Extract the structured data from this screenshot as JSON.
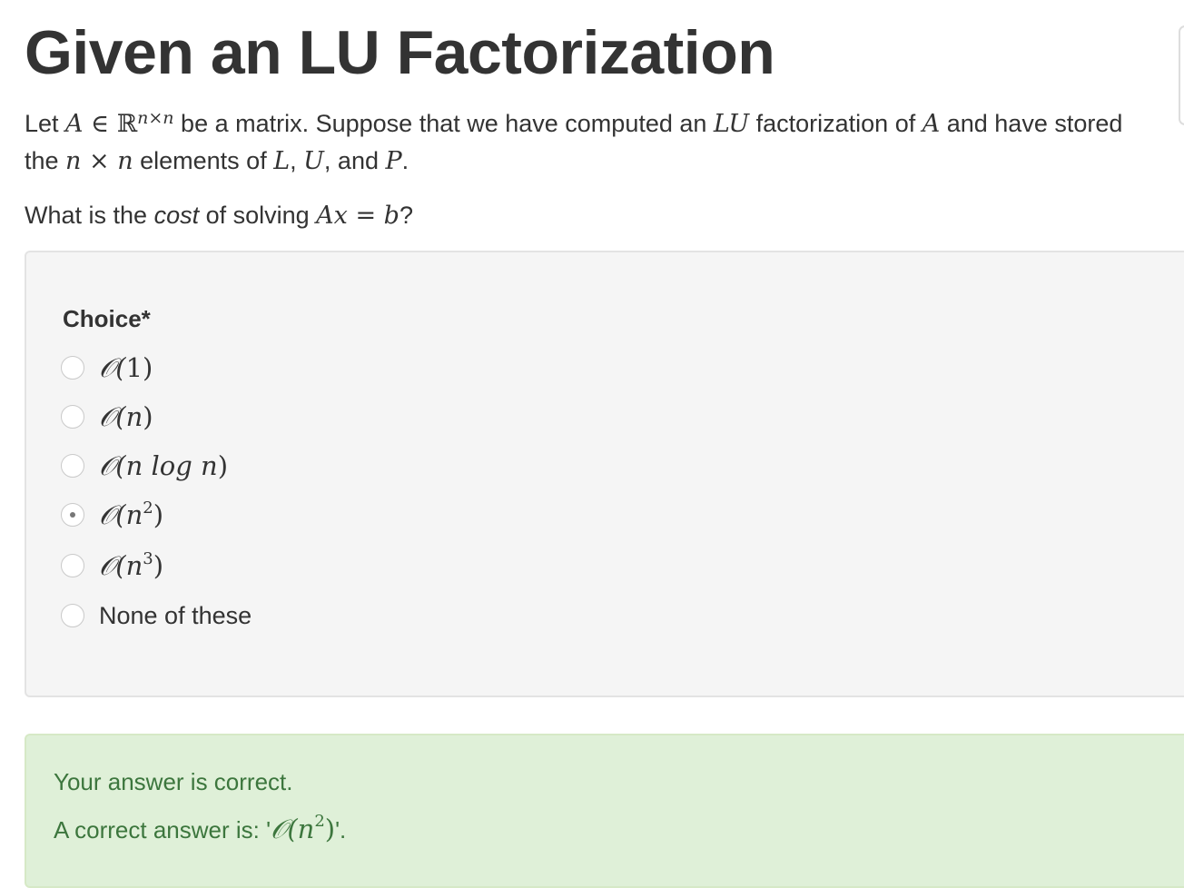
{
  "page": {
    "title": "Given an LU Factorization"
  },
  "question": {
    "p1_let": "Let ",
    "p1_A": "A",
    "p1_in": " ∈ ℝ",
    "p1_sup": "n×n",
    "p1_rest1": " be a matrix. Suppose that we have computed an ",
    "p1_LU": "LU",
    "p1_rest2": " factorization of ",
    "p1_A2": "A",
    "p1_rest3": " and have stored the ",
    "p1_nxn": "n × n",
    "p1_rest4": " elements of ",
    "p1_L": "L",
    "p1_comma1": ", ",
    "p1_U": "U",
    "p1_and": ", and ",
    "p1_P": "P",
    "p1_end": ".",
    "p2_start": "What is the ",
    "p2_cost": "cost",
    "p2_mid": " of solving ",
    "p2_eq": "Ax = b",
    "p2_end": "?"
  },
  "choices": {
    "label": "Choice*",
    "options": [
      {
        "prefix": "𝒪(",
        "body": "1",
        "sup": "",
        "suffix": ")",
        "checked": false
      },
      {
        "prefix": "𝒪(",
        "body": "n",
        "sup": "",
        "suffix": ")",
        "checked": false
      },
      {
        "prefix": "𝒪(",
        "body": "n log n",
        "sup": "",
        "suffix": ")",
        "checked": false
      },
      {
        "prefix": "𝒪(",
        "body": "n",
        "sup": "2",
        "suffix": ")",
        "checked": true
      },
      {
        "prefix": "𝒪(",
        "body": "n",
        "sup": "3",
        "suffix": ")",
        "checked": false
      },
      {
        "text": "None of these",
        "checked": false
      }
    ]
  },
  "feedback": {
    "status": "Your answer is correct.",
    "answer_prefix": "A correct answer is: '",
    "answer_math": "𝒪(n",
    "answer_sup": "2",
    "answer_close": ")",
    "answer_suffix": "'."
  },
  "colors": {
    "panel_bg": "#f5f5f5",
    "success_bg": "#dff0d8",
    "success_text": "#3c763d",
    "text": "#333333"
  }
}
